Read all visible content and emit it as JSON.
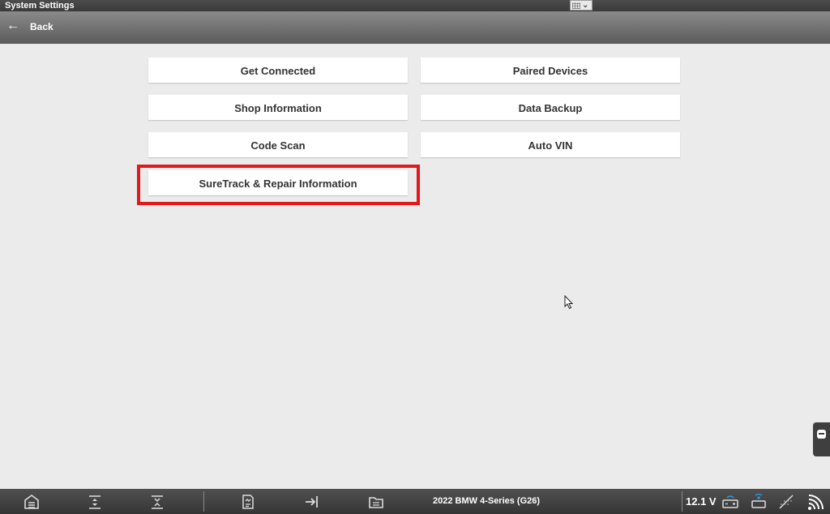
{
  "window": {
    "title": "System Settings"
  },
  "header": {
    "back_label": "Back"
  },
  "settings": {
    "buttons": [
      {
        "label": "Get Connected"
      },
      {
        "label": "Paired Devices"
      },
      {
        "label": "Shop Information"
      },
      {
        "label": "Data Backup"
      },
      {
        "label": "Code Scan"
      },
      {
        "label": "Auto VIN"
      },
      {
        "label": "SureTrack & Repair Information"
      }
    ],
    "highlighted": "SureTrack & Repair Information",
    "highlight_color": "#e0191c"
  },
  "taskbar": {
    "vehicle": "2022 BMW 4-Series (G26)",
    "voltage": "12.1 V",
    "icons": [
      "home-icon",
      "move-up-down-icon",
      "collapse-list-icon",
      "report-icon",
      "exit-arrow-icon",
      "folder-icon",
      "battery-icon",
      "vci-connection-icon",
      "no-signal-icon",
      "wifi-icon"
    ]
  },
  "colors": {
    "accent": "#e0191c",
    "background": "#ebebeb",
    "taskbar": "#404040"
  }
}
